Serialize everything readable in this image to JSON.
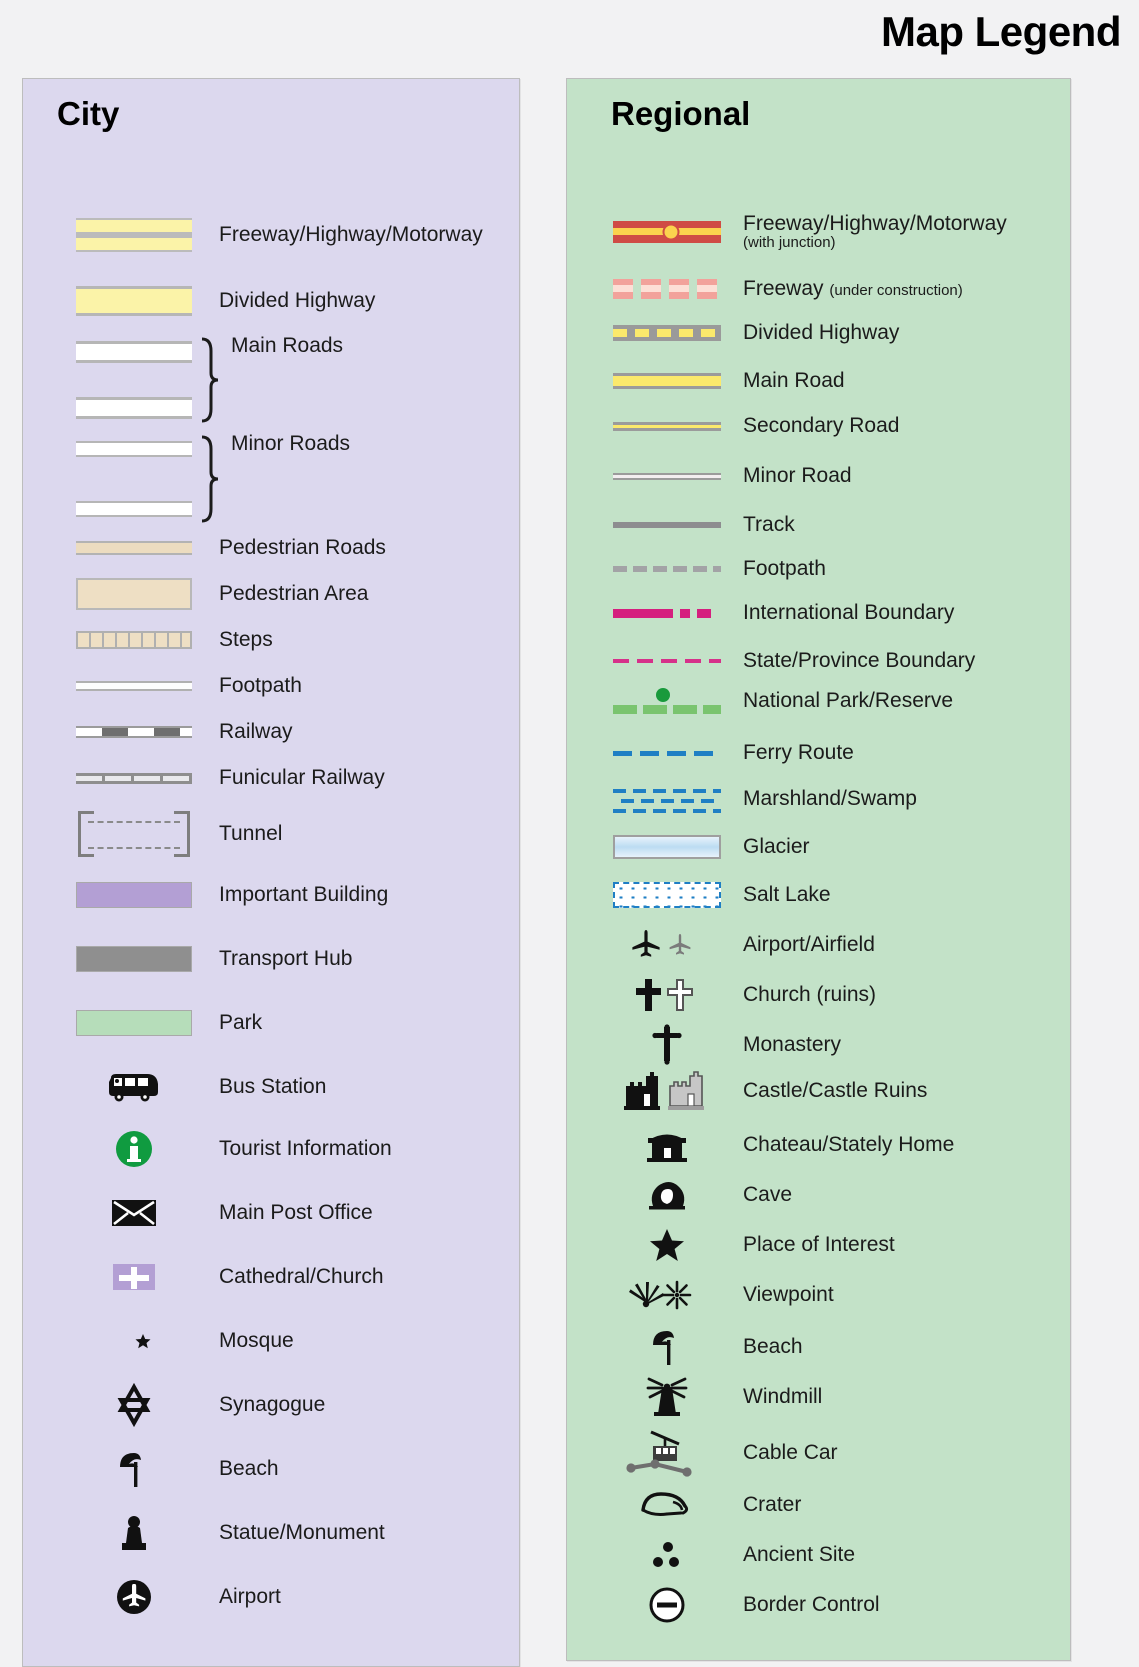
{
  "title": "Map Legend",
  "city": {
    "heading": "City",
    "background": "#dcd8ee",
    "items": [
      {
        "label": "Freeway/Highway/Motorway",
        "icon": "freeway-swatch"
      },
      {
        "label": "Divided Highway",
        "icon": "divided-highway-swatch"
      },
      {
        "label": "Main Roads",
        "icon": "main-roads-swatch"
      },
      {
        "label": "Minor Roads",
        "icon": "minor-roads-swatch"
      },
      {
        "label": "Pedestrian Roads",
        "icon": "pedestrian-road-swatch"
      },
      {
        "label": "Pedestrian Area",
        "icon": "pedestrian-area-swatch"
      },
      {
        "label": "Steps",
        "icon": "steps-swatch"
      },
      {
        "label": "Footpath",
        "icon": "footpath-swatch"
      },
      {
        "label": "Railway",
        "icon": "railway-swatch"
      },
      {
        "label": "Funicular Railway",
        "icon": "funicular-railway-swatch"
      },
      {
        "label": "Tunnel",
        "icon": "tunnel-swatch"
      },
      {
        "label": "Important Building",
        "icon": "important-building-swatch"
      },
      {
        "label": "Transport Hub",
        "icon": "transport-hub-swatch"
      },
      {
        "label": "Park",
        "icon": "park-swatch"
      },
      {
        "label": "Bus Station",
        "icon": "bus-icon"
      },
      {
        "label": "Tourist Information",
        "icon": "information-icon"
      },
      {
        "label": "Main Post Office",
        "icon": "envelope-icon"
      },
      {
        "label": "Cathedral/Church",
        "icon": "church-cross-icon"
      },
      {
        "label": "Mosque",
        "icon": "crescent-star-icon"
      },
      {
        "label": "Synagogue",
        "icon": "star-of-david-icon"
      },
      {
        "label": "Beach",
        "icon": "beach-umbrella-icon"
      },
      {
        "label": "Statue/Monument",
        "icon": "statue-icon"
      },
      {
        "label": "Airport",
        "icon": "airport-circle-icon"
      }
    ]
  },
  "regional": {
    "heading": "Regional",
    "background": "#c3e2c8",
    "items": [
      {
        "label": "Freeway/Highway/Motorway",
        "sublabel": "(with junction)",
        "sub_position": "below",
        "icon": "regional-freeway-junction-swatch"
      },
      {
        "label": "Freeway",
        "sublabel": "(under construction)",
        "sub_position": "inline",
        "icon": "freeway-under-construction-swatch"
      },
      {
        "label": "Divided Highway",
        "icon": "regional-divided-highway-swatch"
      },
      {
        "label": "Main Road",
        "icon": "regional-main-road-swatch"
      },
      {
        "label": "Secondary Road",
        "icon": "secondary-road-swatch"
      },
      {
        "label": "Minor Road",
        "icon": "regional-minor-road-swatch"
      },
      {
        "label": "Track",
        "icon": "track-swatch"
      },
      {
        "label": "Footpath",
        "icon": "regional-footpath-swatch"
      },
      {
        "label": "International Boundary",
        "icon": "international-boundary-swatch"
      },
      {
        "label": "State/Province Boundary",
        "icon": "state-boundary-swatch"
      },
      {
        "label": "National Park/Reserve",
        "icon": "national-park-swatch"
      },
      {
        "label": "Ferry Route",
        "icon": "ferry-route-swatch"
      },
      {
        "label": "Marshland/Swamp",
        "icon": "marshland-swatch"
      },
      {
        "label": "Glacier",
        "icon": "glacier-swatch"
      },
      {
        "label": "Salt Lake",
        "icon": "salt-lake-swatch"
      },
      {
        "label": "Airport/Airfield",
        "icon": "airplane-icon"
      },
      {
        "label": "Church (ruins)",
        "icon": "church-ruins-cross-icon"
      },
      {
        "label": "Monastery",
        "icon": "monastery-cross-icon"
      },
      {
        "label": "Castle/Castle Ruins",
        "icon": "castle-icon"
      },
      {
        "label": "Chateau/Stately Home",
        "icon": "chateau-icon"
      },
      {
        "label": "Cave",
        "icon": "cave-icon"
      },
      {
        "label": "Place of Interest",
        "icon": "star-icon"
      },
      {
        "label": "Viewpoint",
        "icon": "viewpoint-icon"
      },
      {
        "label": "Beach",
        "icon": "beach-umbrella-icon"
      },
      {
        "label": "Windmill",
        "icon": "windmill-icon"
      },
      {
        "label": "Cable Car",
        "icon": "cable-car-icon"
      },
      {
        "label": "Crater",
        "icon": "crater-icon"
      },
      {
        "label": "Ancient Site",
        "icon": "ancient-site-icon"
      },
      {
        "label": "Border Control",
        "icon": "border-control-icon"
      }
    ]
  },
  "colors": {
    "page_background": "#f2f2f3",
    "city_panel": "#dcd8ee",
    "regional_panel": "#c3e2c8",
    "highway_yellow": "#fbf3a8",
    "regional_road_yellow": "#fbe96c",
    "freeway_red": "#cf4b45",
    "junction_yellow": "#fbd24e",
    "pedestrian_tan": "#eedfc4",
    "important_building_purple": "#b39fd4",
    "transport_hub_grey": "#8f8f8f",
    "park_green": "#b6ddba",
    "boundary_magenta": "#d51f7e",
    "national_park_green": "#7ac46f",
    "water_blue": "#1f7fc4",
    "tourist_info_green": "#109b40"
  }
}
